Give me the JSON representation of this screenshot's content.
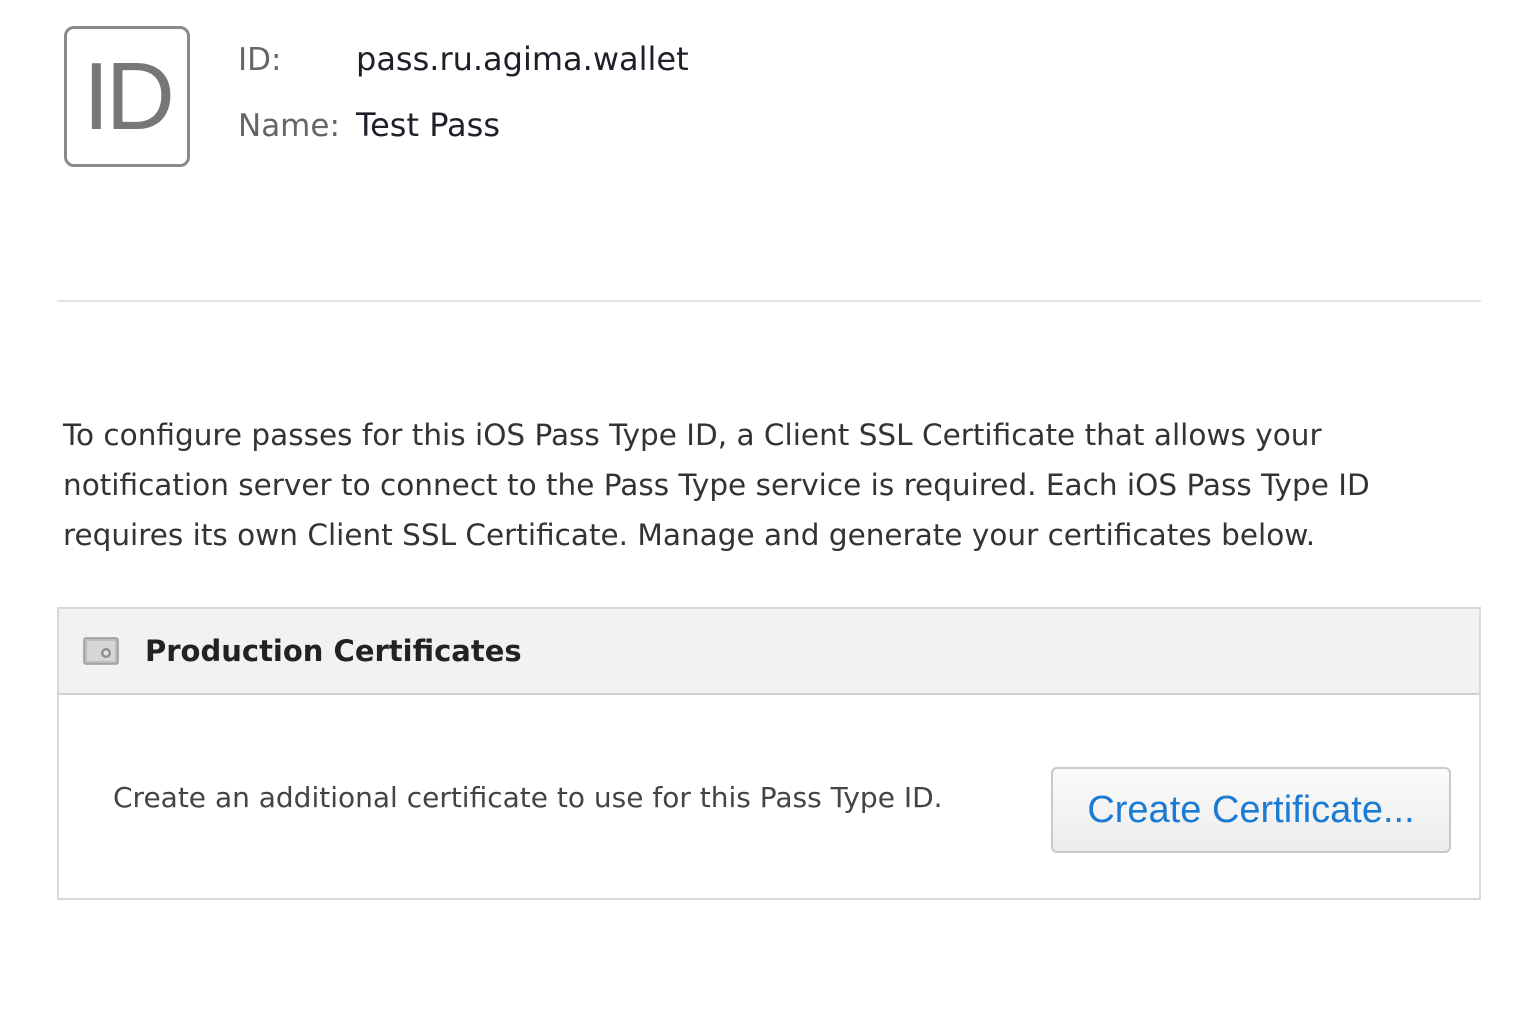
{
  "badge": {
    "text": "ID"
  },
  "meta": {
    "id_label": "ID:",
    "id_value": "pass.ru.agima.wallet",
    "name_label": "Name:",
    "name_value": "Test Pass"
  },
  "description": "To configure passes for this iOS Pass Type ID, a Client SSL Certificate that allows your notification server to connect to the Pass Type service is required. Each iOS Pass Type ID requires its own Client SSL Certificate. Manage and generate your certificates below.",
  "production": {
    "icon": "certificate-icon",
    "title": "Production Certificates",
    "body_text": "Create an additional certificate to use for this Pass Type ID.",
    "button_label": "Create Certificate..."
  },
  "colors": {
    "link_blue": "#1a7ad4",
    "header_bg": "#f2f2f2"
  }
}
